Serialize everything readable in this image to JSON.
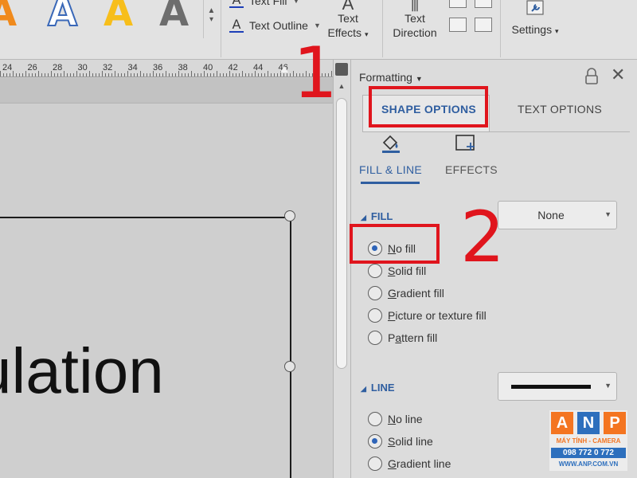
{
  "ribbon": {
    "wordart_styles": [
      {
        "name": "orange-fill",
        "letter": "A",
        "color": "#f08a1c"
      },
      {
        "name": "blue-outline",
        "letter": "A",
        "color": "#3a68b8"
      },
      {
        "name": "yellow-fill",
        "letter": "A",
        "color": "#f7be1b"
      },
      {
        "name": "gray-gradient",
        "letter": "A",
        "color": "#6d6d6d"
      }
    ],
    "text_fill_label": "Text Fill",
    "text_outline_label": "Text Outline",
    "text_effects_label": [
      "Text",
      "Effects"
    ],
    "text_direction_label": [
      "Text",
      "Direction"
    ],
    "settings_label": "Settings"
  },
  "ruler": {
    "numbers": [
      "24",
      "26",
      "28",
      "30",
      "32",
      "34",
      "36",
      "38",
      "40",
      "42",
      "44",
      "46"
    ]
  },
  "document": {
    "text": "culation"
  },
  "pane": {
    "title": "Formatting",
    "tabs": {
      "shape_options": "SHAPE OPTIONS",
      "text_options": "TEXT OPTIONS"
    },
    "categories": {
      "fill_line": "FILL & LINE",
      "effects": "EFFECTS"
    },
    "fill": {
      "heading": "FILL",
      "dropdown_value": "None",
      "options": [
        {
          "label": "No fill",
          "key": "N",
          "selected": true
        },
        {
          "label": "Solid fill",
          "key": "S",
          "selected": false
        },
        {
          "label": "Gradient fill",
          "key": "G",
          "selected": false
        },
        {
          "label": "Picture or texture fill",
          "key": "P",
          "selected": false
        },
        {
          "label": "Pattern fill",
          "key": "a",
          "selected": false
        }
      ]
    },
    "line": {
      "heading": "LINE",
      "options": [
        {
          "label": "No line",
          "key": "N",
          "selected": false
        },
        {
          "label": "Solid line",
          "key": "S",
          "selected": true
        },
        {
          "label": "Gradient line",
          "key": "G",
          "selected": false
        }
      ]
    }
  },
  "annotations": {
    "step_1": "1",
    "step_2": "2",
    "color": "#e0151d"
  },
  "watermark": {
    "letters": [
      "A",
      "N",
      "P"
    ],
    "tagline": "MÁY TÍNH - CAMERA",
    "phone": "098 772 0 772",
    "website": "WWW.ANP.COM.VN",
    "colors": {
      "a": "#f47521",
      "n": "#2d6fbd",
      "p": "#f47521"
    }
  }
}
